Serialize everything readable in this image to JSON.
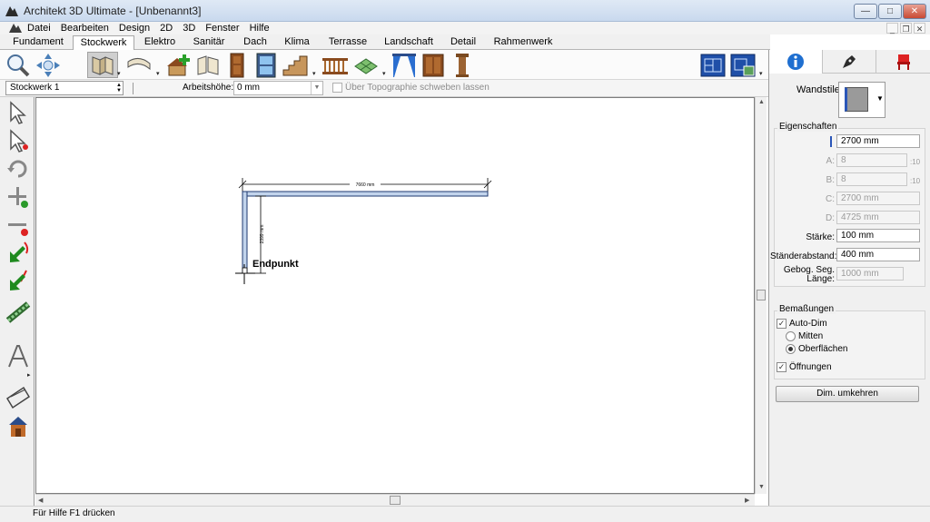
{
  "window": {
    "title": "Architekt 3D Ultimate - [Unbenannt3]",
    "min": "—",
    "max": "□",
    "close": "✕"
  },
  "mdi": {
    "min": "_",
    "restore": "❐",
    "close": "✕"
  },
  "menu": [
    "Datei",
    "Bearbeiten",
    "Design",
    "2D",
    "3D",
    "Fenster",
    "Hilfe"
  ],
  "tabs": [
    "Fundament",
    "Stockwerk",
    "Elektro",
    "Sanitär",
    "Dach",
    "Klima",
    "Terrasse",
    "Landschaft",
    "Detail",
    "Rahmenwerk"
  ],
  "options": {
    "floor": "Stockwerk 1",
    "height_label": "Arbeitshöhe:",
    "height_value": "0 mm",
    "topo_label": "Über Topographie schweben lassen"
  },
  "canvas": {
    "dim_horizontal": "7660 mm",
    "dim_vertical": "2399 mm",
    "snap_label": "Endpunkt"
  },
  "status": "Für Hilfe F1 drücken",
  "panel": {
    "wandstile": "Wandstile",
    "eigenschaften": "Eigenschaften",
    "height": "2700 mm",
    "a_label": "A:",
    "a_value": "8",
    "a_unit": ":10",
    "b_label": "B:",
    "b_value": "8",
    "b_unit": ":10",
    "c_label": "C:",
    "c_value": "2700 mm",
    "d_label": "D:",
    "d_value": "4725 mm",
    "staerke_label": "Stärke:",
    "staerke_value": "100 mm",
    "staender_label": "Ständerabstand:",
    "staender_value": "400 mm",
    "gebog_label": "Gebog. Seg.",
    "gebog_label2": "Länge:",
    "gebog_value": "1000 mm",
    "bemassungen": "Bemaßungen",
    "autodim": "Auto-Dim",
    "mitten": "Mitten",
    "oberflaechen": "Oberflächen",
    "oeffnungen": "Öffnungen",
    "dim_button": "Dim. umkehren"
  }
}
